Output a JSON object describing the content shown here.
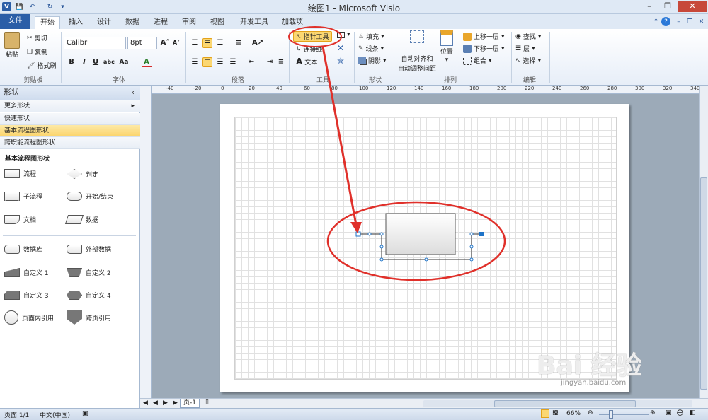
{
  "window": {
    "title": "绘图1 - Microsoft Visio"
  },
  "tabs": {
    "file": "文件",
    "items": [
      "开始",
      "插入",
      "设计",
      "数据",
      "进程",
      "审阅",
      "视图",
      "开发工具",
      "加载项"
    ]
  },
  "ribbon": {
    "clipboard": {
      "paste": "粘贴",
      "cut": "剪切",
      "copy": "复制",
      "format_painter": "格式刷",
      "label": "剪贴板"
    },
    "font": {
      "name": "Calibri",
      "size": "8pt",
      "label": "字体"
    },
    "paragraph": {
      "label": "段落"
    },
    "tools": {
      "pointer": "指针工具",
      "connector": "连接线",
      "text": "文本",
      "label": "工具"
    },
    "shape": {
      "fill": "填充",
      "line": "线条",
      "shadow": "阴影",
      "label": "形状"
    },
    "arrange": {
      "auto_align": "自动对齐和",
      "auto_space": "自动调整间距",
      "position": "位置",
      "bring_forward": "上移一层",
      "send_backward": "下移一层",
      "group": "组合",
      "label": "排列"
    },
    "edit": {
      "find": "查找",
      "layer": "层",
      "select": "选择",
      "label": "编辑"
    }
  },
  "shapes_panel": {
    "title": "形状",
    "more": "更多形状",
    "stencils": [
      "快速形状",
      "基本流程图形状",
      "跨职能流程图形状"
    ],
    "section": "基本流程图形状",
    "items": [
      "流程",
      "判定",
      "子流程",
      "开始/结束",
      "文档",
      "数据",
      "数据库",
      "外部数据",
      "自定义 1",
      "自定义 2",
      "自定义 3",
      "自定义 4",
      "页面内引用",
      "跨页引用"
    ]
  },
  "ruler": {
    "h": [
      "-40",
      "-20",
      "0",
      "20",
      "40",
      "60",
      "80",
      "100",
      "120",
      "140",
      "160",
      "180",
      "200",
      "220",
      "240",
      "260",
      "280",
      "300",
      "320",
      "340"
    ]
  },
  "page_tab": "页-1",
  "status": {
    "page": "页面 1/1",
    "lang": "中文(中国)",
    "zoom": "66%"
  },
  "watermark": {
    "brand": "Bai 经验",
    "url": "jingyan.baidu.com"
  },
  "colors": {
    "accent": "#2b5ea7",
    "highlight": "#fbd772",
    "annotation": "#e0302a"
  }
}
